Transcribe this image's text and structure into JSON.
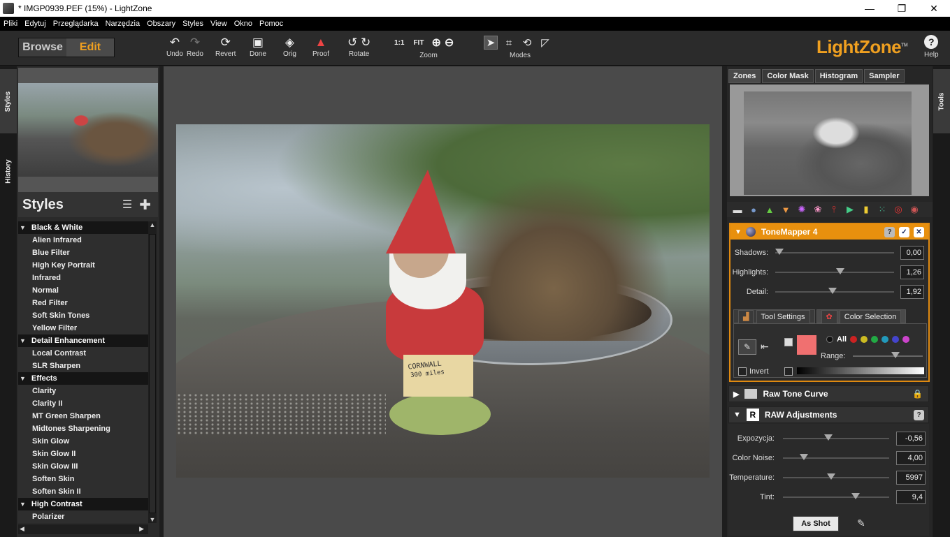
{
  "window": {
    "title": "* IMGP0939.PEF (15%) - LightZone",
    "minimize": "—",
    "maximize": "❐",
    "close": "✕"
  },
  "menu": [
    "Pliki",
    "Edytuj",
    "Przeglądarka",
    "Narzędzia",
    "Obszary",
    "Styles",
    "View",
    "Okno",
    "Pomoc"
  ],
  "toolbar": {
    "browse": "Browse",
    "edit": "Edit",
    "undo": "Undo",
    "redo": "Redo",
    "revert": "Revert",
    "done": "Done",
    "orig": "Orig",
    "proof": "Proof",
    "rotate": "Rotate",
    "zoom_label": "Zoom",
    "zoom_1to1": "1:1",
    "zoom_fit": "FIT",
    "modes_label": "Modes",
    "logo": "LightZone",
    "logo_tm": "TM",
    "help": "Help"
  },
  "left_tabs": {
    "styles": "Styles",
    "history": "History"
  },
  "right_tabs": {
    "tools": "Tools"
  },
  "styles_panel": {
    "title": "Styles",
    "groups": [
      {
        "name": "Black & White",
        "items": [
          "Alien Infrared",
          "Blue Filter",
          "High Key Portrait",
          "Infrared",
          "Normal",
          "Red Filter",
          "Soft Skin Tones",
          "Yellow Filter"
        ]
      },
      {
        "name": "Detail Enhancement",
        "items": [
          "Local Contrast",
          "SLR Sharpen"
        ]
      },
      {
        "name": "Effects",
        "items": [
          "Clarity",
          "Clarity II",
          "MT Green Sharpen",
          "Midtones Sharpening",
          "Skin Glow",
          "Skin Glow II",
          "Skin Glow III",
          "Soften Skin",
          "Soften Skin II"
        ]
      },
      {
        "name": "High Contrast",
        "items": [
          "Polarizer"
        ]
      }
    ]
  },
  "photo": {
    "sign_line1": "CORNWALL",
    "sign_line2": "300 miles"
  },
  "right_panel": {
    "tabs": [
      "Zones",
      "Color Mask",
      "Histogram",
      "Sampler"
    ],
    "tonemapper": {
      "title": "ToneMapper 4",
      "help": "?",
      "check": "✓",
      "close": "✕",
      "sliders": [
        {
          "label": "Shadows:",
          "value": "0,00",
          "level": 0.0
        },
        {
          "label": "Highlights:",
          "value": "1,26",
          "level": 0.55
        },
        {
          "label": "Detail:",
          "value": "1,92",
          "level": 0.48
        }
      ],
      "subtabs": [
        "Tool Settings",
        "Color Selection"
      ],
      "all_label": "All",
      "range_label": "Range:",
      "invert_label": "Invert",
      "swatch_color": "#f07070"
    },
    "raw_tone_curve": "Raw Tone Curve",
    "raw_adjustments": {
      "title": "RAW Adjustments",
      "help": "?",
      "sliders": [
        {
          "label": "Expozycja:",
          "value": "-0,56",
          "level": 0.42
        },
        {
          "label": "Color Noise:",
          "value": "4,00",
          "level": 0.17
        },
        {
          "label": "Temperature:",
          "value": "5997",
          "level": 0.45
        },
        {
          "label": "Tint:",
          "value": "9,4",
          "level": 0.7
        }
      ],
      "as_shot": "As Shot"
    }
  },
  "colors": {
    "accent": "#f0a020",
    "panel_header": "#e8900e"
  }
}
